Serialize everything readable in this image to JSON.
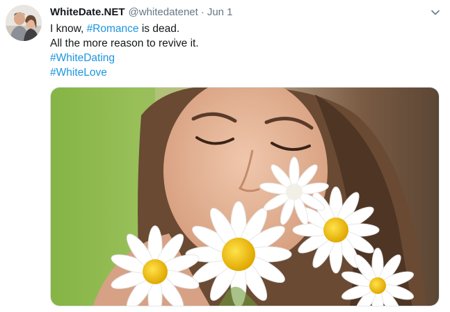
{
  "tweet": {
    "author": {
      "display_name": "WhiteDate.NET",
      "handle": "@whitedatenet",
      "avatar_icon": "profile-photo-couple"
    },
    "separator": "·",
    "date": "Jun 1",
    "menu_icon": "chevron-down-icon",
    "text": {
      "line1_prefix": "I know, ",
      "line1_hashtag": "#Romance",
      "line1_suffix": " is dead.",
      "line2": "All the more reason to revive it.",
      "hashtag1": "#WhiteDating",
      "hashtag2": "#WhiteLove"
    },
    "media": {
      "kind": "photo",
      "icon": "woman-smelling-daisies-photo"
    }
  },
  "colors": {
    "text": "#14171a",
    "secondary": "#657786",
    "link": "#1b95e0",
    "border": "#e1e8ed"
  }
}
